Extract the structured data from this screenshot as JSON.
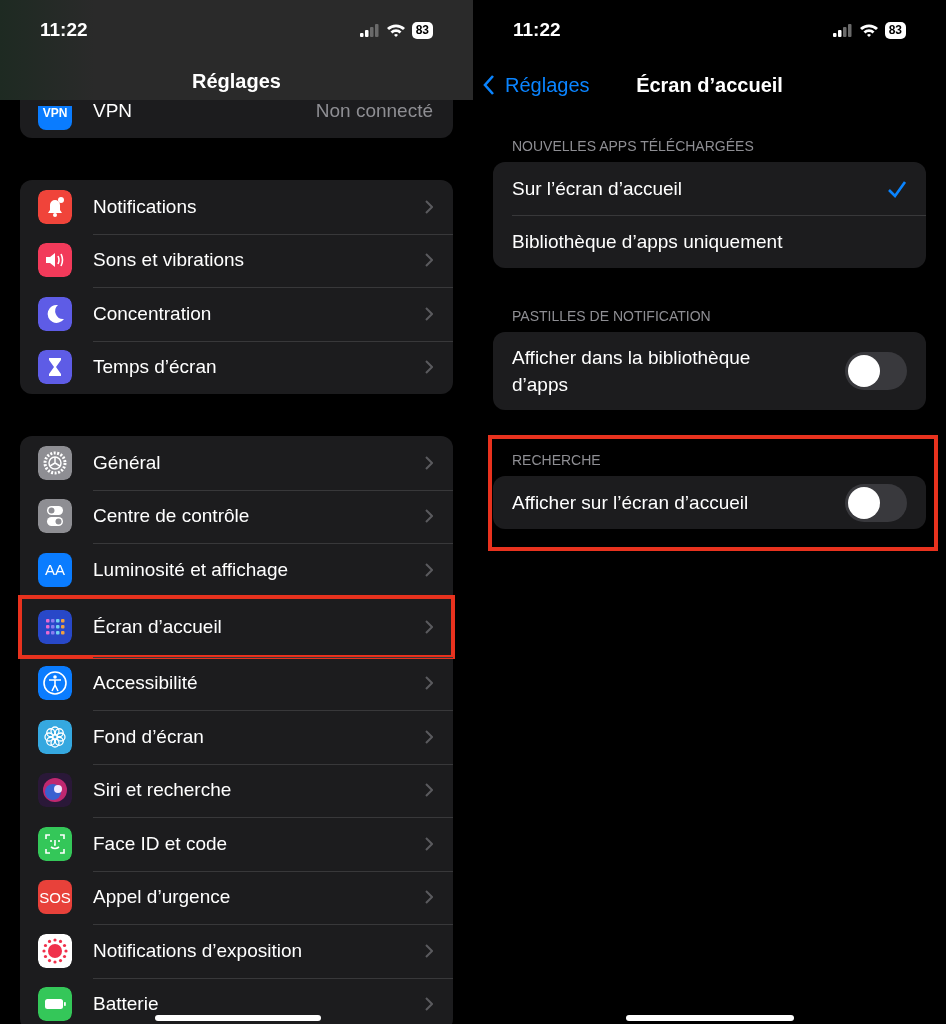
{
  "left": {
    "status_bar": {
      "time": "11:22",
      "battery": "83"
    },
    "title": "Réglages",
    "partial_row": {
      "label": "VPN",
      "value": "Non connecté",
      "icon_text": "VPN",
      "color": "#0a7cff"
    },
    "groups": [
      [
        {
          "label": "Notifications",
          "kind": "bell",
          "color": "#f0443a",
          "highlighted": false
        },
        {
          "label": "Sons et vibrations",
          "kind": "sound",
          "color": "#f23a5a",
          "highlighted": false
        },
        {
          "label": "Concentration",
          "kind": "moon",
          "color": "#5e5ce6",
          "highlighted": false
        },
        {
          "label": "Temps d’écran",
          "kind": "hourglass",
          "color": "#5e5ce6",
          "highlighted": false
        }
      ],
      [
        {
          "label": "Général",
          "kind": "gear",
          "color": "#8e8e93",
          "highlighted": false
        },
        {
          "label": "Centre de contrôle",
          "kind": "switches",
          "color": "#8e8e93",
          "highlighted": false
        },
        {
          "label": "Luminosité et affichage",
          "kind": "text",
          "icon_text": "AA",
          "color": "#0a7cff",
          "highlighted": false
        },
        {
          "label": "Écran d’accueil",
          "kind": "grid",
          "color": "#2848c8",
          "highlighted": true
        },
        {
          "label": "Accessibilité",
          "kind": "person",
          "color": "#0a7cff",
          "highlighted": false
        },
        {
          "label": "Fond d’écran",
          "kind": "flower",
          "color": "#35a8e0",
          "highlighted": false
        },
        {
          "label": "Siri et recherche",
          "kind": "orb",
          "color": "#2a1838",
          "highlighted": false
        },
        {
          "label": "Face ID et code",
          "kind": "face",
          "color": "#34c759",
          "highlighted": false
        },
        {
          "label": "Appel d’urgence",
          "kind": "text",
          "icon_text": "SOS",
          "color": "#e8413a",
          "highlighted": false
        },
        {
          "label": "Notifications d’exposition",
          "kind": "dots",
          "color": "#ffffff",
          "highlighted": false
        },
        {
          "label": "Batterie",
          "kind": "battery",
          "color": "#34c759",
          "highlighted": false
        }
      ]
    ]
  },
  "right": {
    "status_bar": {
      "time": "11:22",
      "battery": "83"
    },
    "back_label": "Réglages",
    "title": "Écran d’accueil",
    "sections": [
      {
        "header": "NOUVELLES APPS TÉLÉCHARGÉES",
        "highlighted": false,
        "rows": [
          {
            "kind": "option",
            "label": "Sur l’écran d’accueil",
            "selected": true
          },
          {
            "kind": "option",
            "label": "Bibliothèque d’apps uniquement",
            "selected": false
          }
        ]
      },
      {
        "header": "PASTILLES DE NOTIFICATION",
        "highlighted": false,
        "rows": [
          {
            "kind": "toggle",
            "label": "Afficher dans la bibliothèque d’apps",
            "on": false
          }
        ]
      },
      {
        "header": "RECHERCHE",
        "highlighted": true,
        "rows": [
          {
            "kind": "toggle",
            "label": "Afficher sur l’écran d’accueil",
            "on": false
          }
        ]
      }
    ]
  }
}
